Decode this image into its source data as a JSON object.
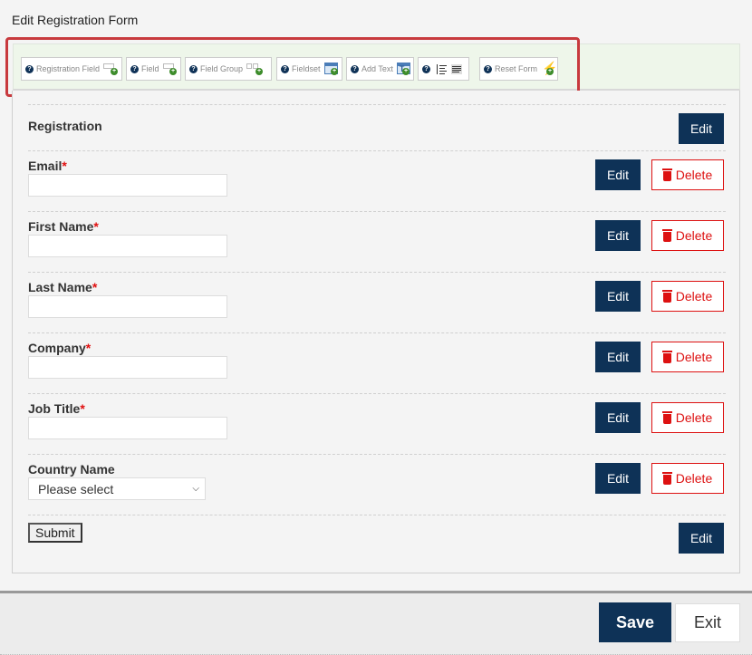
{
  "page": {
    "title": "Edit Registration Form"
  },
  "toolbar": {
    "items": [
      {
        "label": "Registration Field",
        "icon": "field-add-icon"
      },
      {
        "label": "Field",
        "icon": "field-add-icon"
      },
      {
        "label": "Field Group",
        "icon": "field-group-add-icon"
      },
      {
        "label": "Fieldset",
        "icon": "fieldset-add-icon"
      },
      {
        "label": "Add Text",
        "icon": "text-add-icon"
      },
      {
        "label": "",
        "icon": "align-icons"
      },
      {
        "label": "Reset Form",
        "icon": "reset-bolt-icon"
      }
    ],
    "help_glyph": "?"
  },
  "form": {
    "heading": "Registration",
    "fields": [
      {
        "label": "Email",
        "required": true,
        "type": "text",
        "value": ""
      },
      {
        "label": "First Name",
        "required": true,
        "type": "text",
        "value": ""
      },
      {
        "label": "Last Name",
        "required": true,
        "type": "text",
        "value": ""
      },
      {
        "label": "Company",
        "required": true,
        "type": "text",
        "value": ""
      },
      {
        "label": "Job Title",
        "required": true,
        "type": "text",
        "value": ""
      },
      {
        "label": "Country Name",
        "required": false,
        "type": "select",
        "value": "Please select"
      }
    ],
    "required_marker": "*",
    "submit_label": "Submit",
    "edit_label": "Edit",
    "delete_label": "Delete"
  },
  "footer": {
    "save_label": "Save",
    "exit_label": "Exit"
  },
  "colors": {
    "primary": "#0e3257",
    "danger": "#dd1111",
    "highlight": "#c83a3e",
    "toolbar_bg": "#eef6ea"
  }
}
